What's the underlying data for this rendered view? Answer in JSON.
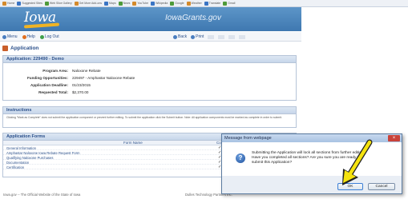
{
  "favorites_bar": {
    "items": [
      {
        "label": "Home",
        "icon": "favorite-page-icon"
      },
      {
        "label": "Suggested Sites",
        "icon": "favorite-page-icon"
      },
      {
        "label": "Web Slice Gallery",
        "icon": "favorite-page-icon"
      },
      {
        "label": "Get More Add-ons",
        "icon": "favorite-page-icon"
      },
      {
        "label": "Maps",
        "icon": "favorite-page-icon"
      },
      {
        "label": "News",
        "icon": "favorite-page-icon"
      },
      {
        "label": "YouTube",
        "icon": "favorite-page-icon"
      },
      {
        "label": "Wikipedia",
        "icon": "favorite-page-icon"
      },
      {
        "label": "Google",
        "icon": "favorite-page-icon"
      },
      {
        "label": "Weather",
        "icon": "favorite-page-icon"
      },
      {
        "label": "Translate",
        "icon": "favorite-page-icon"
      },
      {
        "label": "Gmail",
        "icon": "favorite-page-icon"
      }
    ]
  },
  "header": {
    "logo_text": "Iowa",
    "site_name": "IowaGrants.gov"
  },
  "toolbar": {
    "menu_label": "Menu",
    "help_label": "Help",
    "logout_label": "Log Out",
    "back_label": "Back",
    "print_label": "Print"
  },
  "section_title": "Application",
  "application": {
    "panel_title": "Application: 229490 - Demo",
    "fields": [
      {
        "label": "Program Area:",
        "value": "Naloxone Rebate"
      },
      {
        "label": "Funding Opportunities:",
        "value": "229497 - Amphastar Naloxone Rebate"
      },
      {
        "label": "Application Deadline:",
        "value": "01/23/2015"
      },
      {
        "label": "Requested Total:",
        "value": "$2,370.00"
      }
    ]
  },
  "instructions": {
    "title": "Instructions",
    "text": "Clicking \"Mark as Complete\" does not submit the application component or prevent further editing. To submit the application click the Submit button. Note: All application components must be marked as complete in order to submit."
  },
  "forms": {
    "title": "Application Forms",
    "col_name": "Form Name",
    "col_complete": "Complete",
    "rows": [
      {
        "name": "General Information",
        "check": "✓"
      },
      {
        "name": "Amphastar Naloxone Iowa Rebate Request Form",
        "check": "✓"
      },
      {
        "name": "Qualifying Naloxone Purchases",
        "check": "✓"
      },
      {
        "name": "Documentation",
        "check": "✓"
      },
      {
        "name": "Certification",
        "check": "✓"
      }
    ]
  },
  "footer": {
    "left": "Iowa.gov -- The Official Website of the State of Iowa",
    "right": "Dulles Technology Partners Inc."
  },
  "dialog": {
    "title": "Message from webpage",
    "close_glyph": "×",
    "icon_glyph": "?",
    "message": "Submitting the Application will lock all sections from further editing. Have you completed all sections? Are you sure you are ready to submit this Application?",
    "ok_label": "OK",
    "cancel_label": "Cancel"
  },
  "colors": {
    "banner": "#4a85be",
    "arrow": "#f5e30e"
  }
}
